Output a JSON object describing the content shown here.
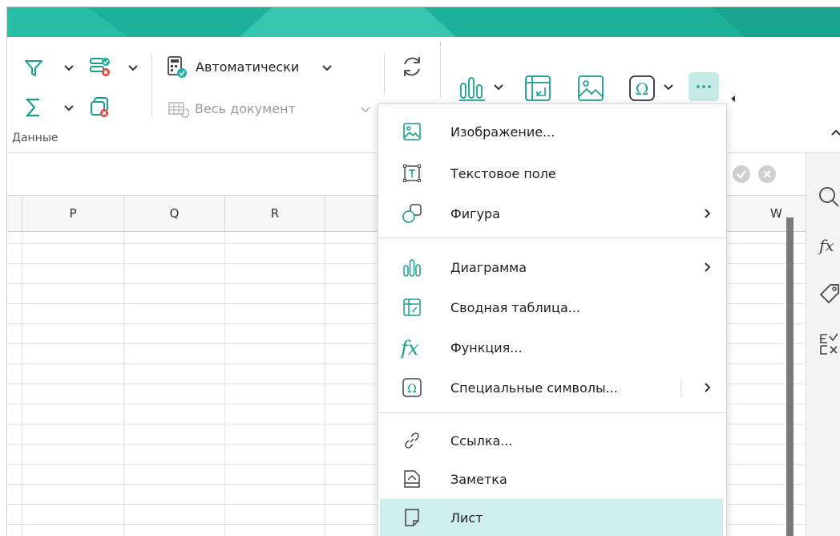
{
  "ribbon": {
    "calc_mode_label": "Автоматически",
    "recalc_scope_label": "Весь документ",
    "group_label": "Данные"
  },
  "columns": [
    "P",
    "Q",
    "R",
    "W"
  ],
  "insert_menu": {
    "items": [
      {
        "label": "Изображение...",
        "icon": "image-icon",
        "submenu": false
      },
      {
        "label": "Текстовое поле",
        "icon": "text-box-icon",
        "submenu": false
      },
      {
        "label": "Фигура",
        "icon": "shape-icon",
        "submenu": true
      },
      {
        "label": "Диаграмма",
        "icon": "chart-icon",
        "submenu": true
      },
      {
        "label": "Сводная таблица...",
        "icon": "pivot-table-icon",
        "submenu": false
      },
      {
        "label": "Функция...",
        "icon": "function-icon",
        "submenu": false
      },
      {
        "label": "Специальные символы...",
        "icon": "omega-icon",
        "submenu": true
      },
      {
        "label": "Ссылка...",
        "icon": "link-icon",
        "submenu": false
      },
      {
        "label": "Заметка",
        "icon": "note-icon",
        "submenu": false
      },
      {
        "label": "Лист",
        "icon": "sheet-icon",
        "submenu": false,
        "highlighted": true
      }
    ]
  },
  "colors": {
    "accent": "#1db09a",
    "icon": "#16a08b",
    "highlight": "#cdeeea",
    "error": "#e0413a"
  }
}
